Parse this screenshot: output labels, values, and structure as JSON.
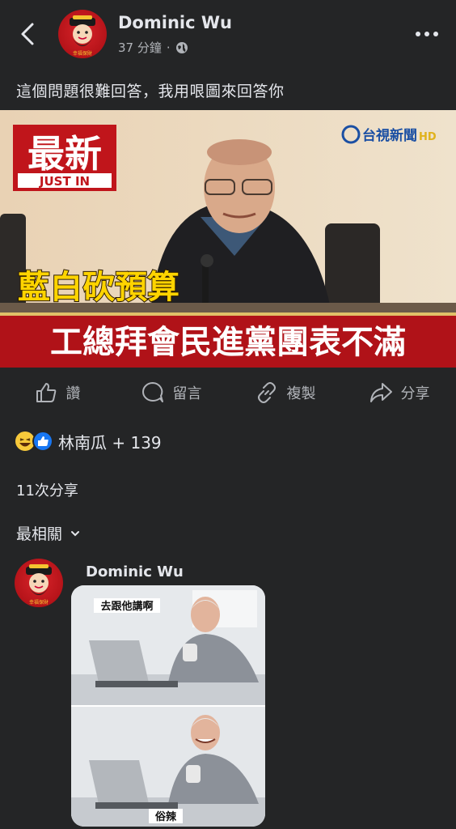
{
  "header": {
    "back_icon": "chevron-left-icon",
    "poster_name": "Dominic Wu",
    "time": "37 分鐘",
    "separator": "·",
    "privacy_icon": "globe-icon",
    "more_icon": "more-horizontal-icon",
    "avatar_text": "幸福保財"
  },
  "post": {
    "text": "這個問題很難回答，我用哏圖來回答你",
    "image": {
      "badge_title": "最新",
      "badge_sub": "JUST IN",
      "logo": "台視新聞",
      "logo_hd": "HD",
      "headline_1": "藍白砍預算",
      "headline_2": "工總拜會民進黨團表不滿"
    }
  },
  "actions": [
    {
      "label": "讚",
      "icon": "thumbs-up-icon"
    },
    {
      "label": "留言",
      "icon": "comment-icon"
    },
    {
      "label": "複製",
      "icon": "link-icon"
    },
    {
      "label": "分享",
      "icon": "share-icon"
    }
  ],
  "reactions": {
    "text": "林南瓜 + 139",
    "icons": [
      "haha-icon",
      "like-icon"
    ]
  },
  "shares": "11次分享",
  "sort": {
    "label": "最相關",
    "icon": "chevron-down-icon"
  },
  "comment": {
    "author": "Dominic Wu",
    "avatar_text": "幸福保財",
    "meme_top_caption": "去跟他講啊",
    "meme_bottom_caption": "俗辣"
  },
  "colors": {
    "background": "#242526",
    "text_primary": "#e4e6eb",
    "text_secondary": "#b0b3b8",
    "news_red": "#c0151b",
    "news_yellow": "#ffd400"
  }
}
